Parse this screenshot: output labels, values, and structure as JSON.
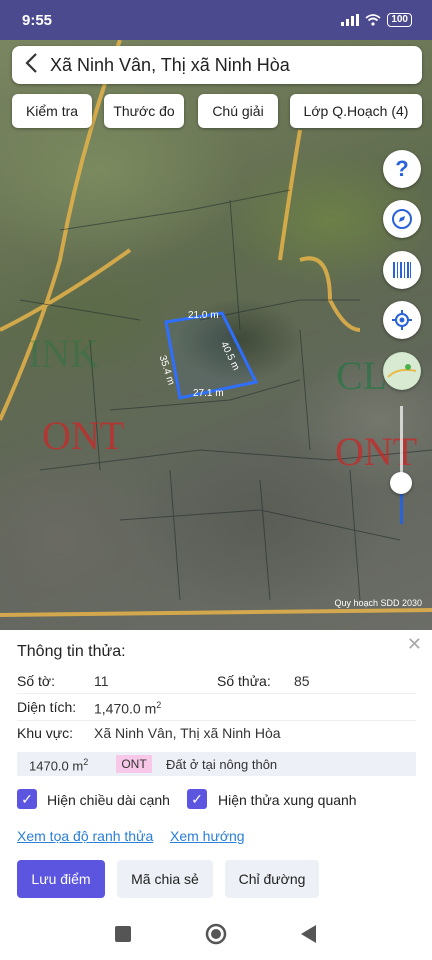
{
  "status_bar": {
    "time": "9:55",
    "battery": "100"
  },
  "header": {
    "back_icon": "chevron-left-icon",
    "title": "Xã Ninh Vân, Thị xã Ninh Hòa"
  },
  "map_tabs": [
    "Kiểm tra",
    "Thước đo",
    "Chú giải",
    "Lớp Q.Hoạch (4)"
  ],
  "map": {
    "zone_labels": [
      "ONT",
      "ONT",
      "INK",
      "CL"
    ],
    "parcel_edges": [
      "21.0 m",
      "40.5 m",
      "27.1 m",
      "35.4 m"
    ],
    "attribution": "Quy hoạch SDD 2030"
  },
  "side_buttons": [
    "help-icon",
    "compass-icon",
    "barcode-icon",
    "locate-icon",
    "layers-thumbnail"
  ],
  "panel": {
    "title": "Thông tin thửa:",
    "so_to_label": "Số tờ:",
    "so_to_value": "11",
    "so_thua_label": "Số thửa:",
    "so_thua_value": "85",
    "dien_tich_label": "Diện tích:",
    "dien_tich_value": "1,470.0 m",
    "dien_tich_sup": "2",
    "khu_vuc_label": "Khu vực:",
    "khu_vuc_value": "Xã Ninh Vân, Thị xã Ninh Hòa",
    "land_area": "1470.0 m",
    "land_area_sup": "2",
    "land_code": "ONT",
    "land_desc": "Đất ở tại nông thôn",
    "check1": "Hiện chiều dài cạnh",
    "check2": "Hiện thửa xung quanh",
    "link1": "Xem tọa độ ranh thửa",
    "link2": "Xem hướng",
    "btn_save": "Lưu điểm",
    "btn_share": "Mã chia sẻ",
    "btn_route": "Chỉ đường"
  },
  "colors": {
    "accent": "#5b55e0",
    "link": "#2a7fd6",
    "parcel": "#2f6fff",
    "badge": "#f8c8e8"
  }
}
